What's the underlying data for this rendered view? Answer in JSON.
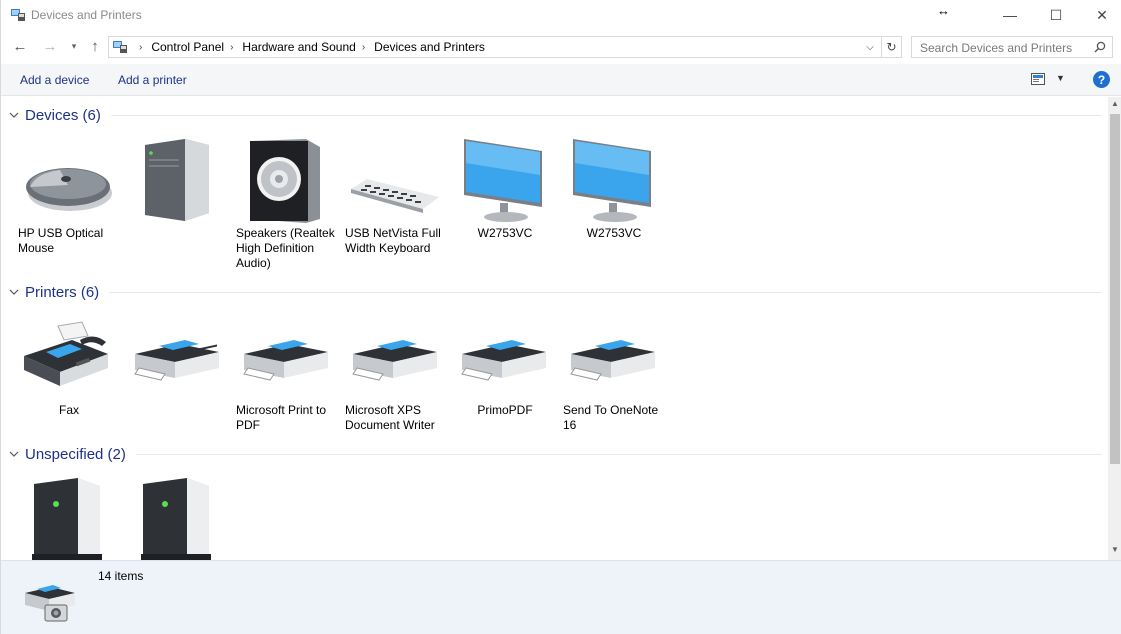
{
  "window": {
    "title": "Devices and Printers",
    "minimize_glyph": "—",
    "maximize_glyph": "☐",
    "close_glyph": "✕",
    "resize_cursor_glyph": "↔"
  },
  "nav": {
    "back_glyph": "←",
    "forward_glyph": "→",
    "recent_glyph": "▾",
    "up_glyph": "↑",
    "breadcrumbs": [
      "Control Panel",
      "Hardware and Sound",
      "Devices and Printers"
    ],
    "crumb_separator": "›",
    "dropdown_glyph": "⌵",
    "refresh_glyph": "↻",
    "search_placeholder": "Search Devices and Printers"
  },
  "commands": {
    "add_device": "Add a device",
    "add_printer": "Add a printer",
    "view_dropdown_glyph": "▼",
    "help_label": "?"
  },
  "groups": [
    {
      "title": "Devices (6)",
      "items": [
        {
          "label": "HP USB Optical Mouse",
          "icon": "mouse-icon"
        },
        {
          "label": "",
          "icon": "computer-tower-icon"
        },
        {
          "label": "Speakers (Realtek High Definition Audio)",
          "icon": "speaker-icon"
        },
        {
          "label": "USB NetVista Full Width Keyboard",
          "icon": "keyboard-icon"
        },
        {
          "label": "W2753VC",
          "icon": "monitor-icon"
        },
        {
          "label": "W2753VC",
          "icon": "monitor-icon"
        }
      ]
    },
    {
      "title": "Printers (6)",
      "items": [
        {
          "label": "Fax",
          "icon": "fax-icon"
        },
        {
          "label": "",
          "icon": "printer-icon"
        },
        {
          "label": "Microsoft Print to PDF",
          "icon": "printer-icon"
        },
        {
          "label": "Microsoft XPS Document Writer",
          "icon": "printer-icon"
        },
        {
          "label": "PrimoPDF",
          "icon": "printer-icon"
        },
        {
          "label": "Send To OneNote 16",
          "icon": "printer-icon"
        }
      ]
    },
    {
      "title": "Unspecified (2)",
      "items": [
        {
          "label": "",
          "icon": "unspecified-device-icon"
        },
        {
          "label": "",
          "icon": "unspecified-device-icon"
        }
      ]
    }
  ],
  "details": {
    "count": "14 items",
    "icon": "devices-and-printers-icon"
  },
  "colors": {
    "accent_text": "#1e3287",
    "group_title": "#1e3287",
    "command_bar_bg": "#f5f6f7",
    "details_bg": "#eef3fa",
    "monitor_screen": "#3aa5ec",
    "help_blue": "#1f6fd1"
  }
}
